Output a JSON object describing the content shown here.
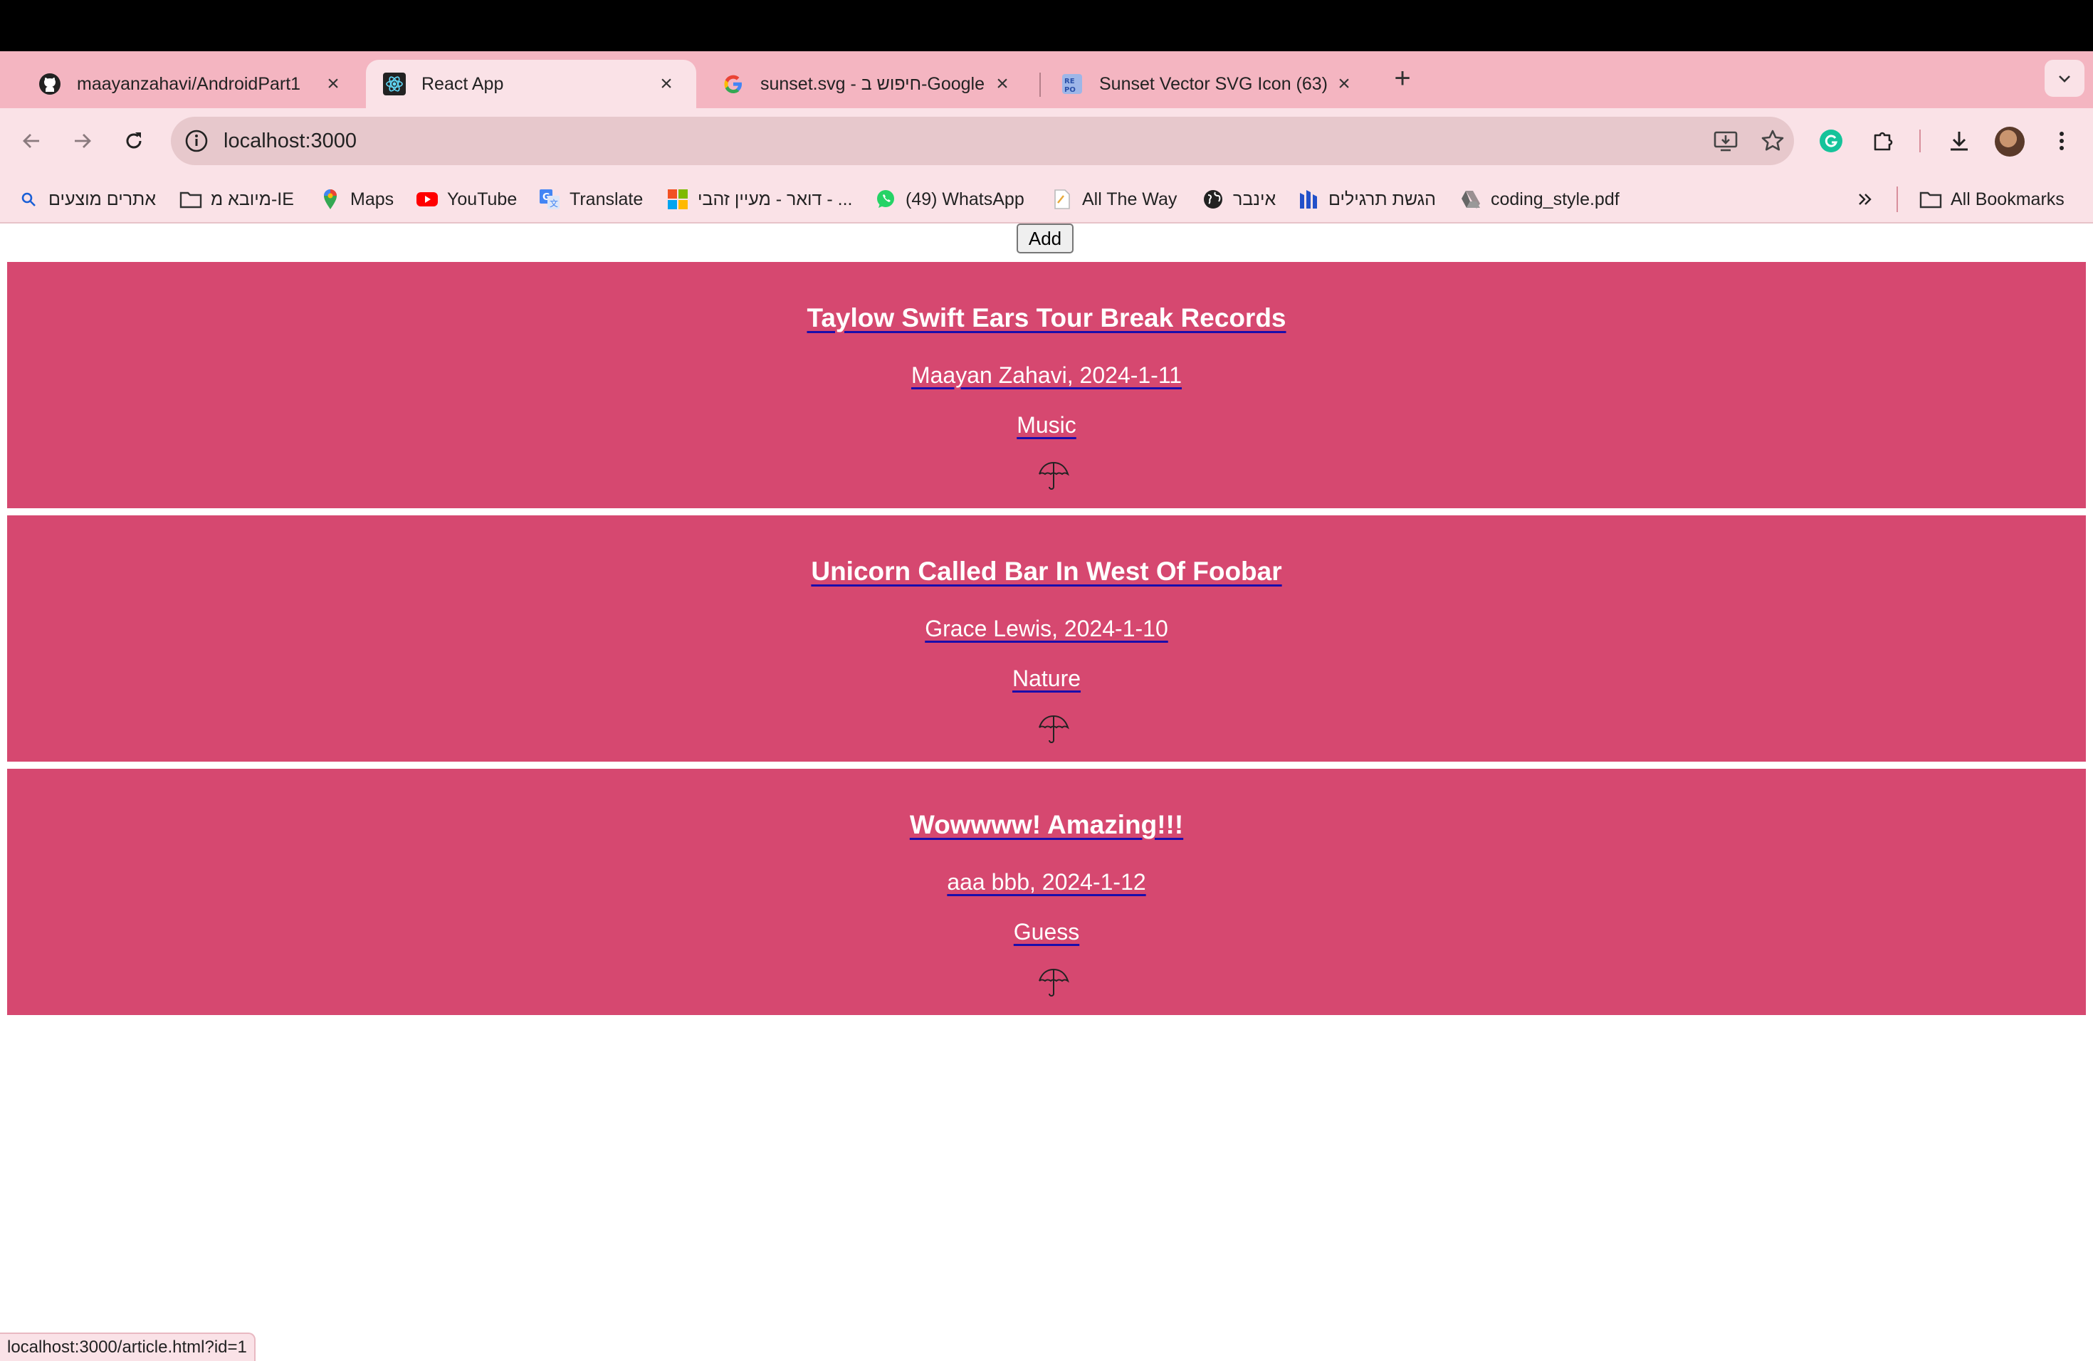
{
  "browser": {
    "tabs": [
      {
        "title": "maayanzahavi/AndroidPart1",
        "favicon": "github-icon"
      },
      {
        "title": "React App",
        "favicon": "react-icon",
        "active": true
      },
      {
        "title": "sunset.svg - חיפוש ב-Google",
        "favicon": "google-icon"
      },
      {
        "title": "Sunset Vector SVG Icon (63)",
        "favicon": "svgrepo-icon"
      }
    ],
    "url": "localhost:3000",
    "bookmarks": [
      {
        "label": "אתרים מוצעים",
        "icon": "search-icon"
      },
      {
        "label": "מיובא מ-IE",
        "icon": "folder-icon"
      },
      {
        "label": "Maps",
        "icon": "maps-icon"
      },
      {
        "label": "YouTube",
        "icon": "youtube-icon"
      },
      {
        "label": "Translate",
        "icon": "translate-icon"
      },
      {
        "label": "דואר - מעיין זהבי - ...",
        "icon": "microsoft-icon"
      },
      {
        "label": "(49) WhatsApp",
        "icon": "whatsapp-icon"
      },
      {
        "label": "All The Way",
        "icon": "page-icon"
      },
      {
        "label": "אינבר",
        "icon": "globe-icon"
      },
      {
        "label": "הגשת תרגילים",
        "icon": "moodle-icon"
      },
      {
        "label": "coding_style.pdf",
        "icon": "drive-icon"
      }
    ],
    "all_bookmarks": "All Bookmarks",
    "status_url": "localhost:3000/article.html?id=1"
  },
  "page": {
    "add_label": "Add",
    "articles": [
      {
        "title": "Taylow Swift Ears Tour Break Records",
        "meta": "Maayan Zahavi, 2024-1-11",
        "category": "Music",
        "icon": "umbrella-icon"
      },
      {
        "title": "Unicorn Called Bar In West Of Foobar",
        "meta": "Grace Lewis, 2024-1-10",
        "category": "Nature",
        "icon": "umbrella-icon"
      },
      {
        "title": "Wowwww! Amazing!!!",
        "meta": "aaa bbb, 2024-1-12",
        "category": "Guess",
        "icon": "umbrella-icon"
      }
    ]
  },
  "colors": {
    "article_bg": "#d64870",
    "tabstrip_bg": "#f4b5c1",
    "toolbar_bg": "#fae2e7",
    "link_underline": "#1a0dab"
  }
}
